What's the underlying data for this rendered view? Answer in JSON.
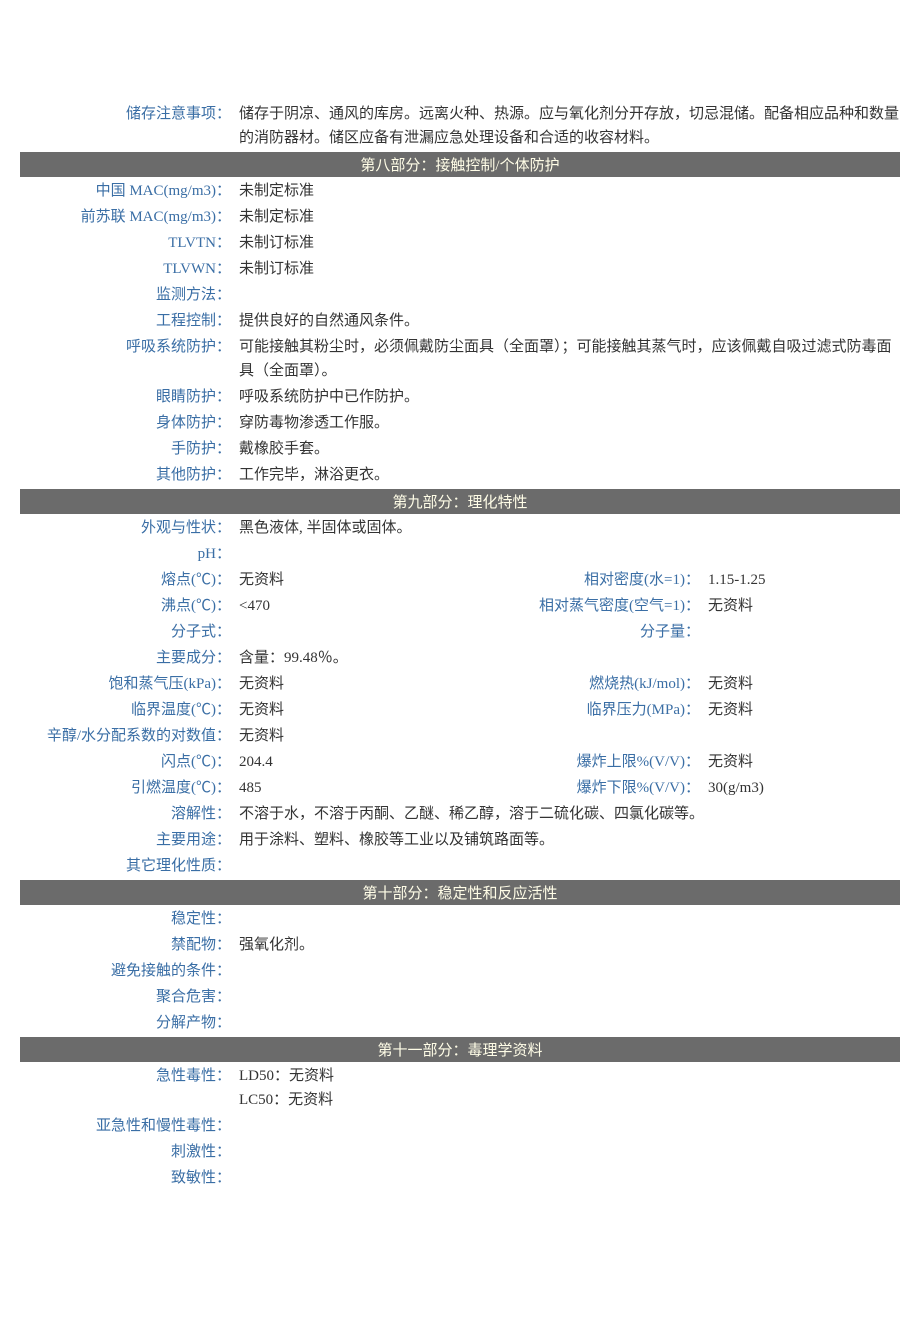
{
  "top": {
    "storage_label": "储存注意事项：",
    "storage_value": "储存于阴凉、通风的库房。远离火种、热源。应与氧化剂分开存放，切忌混储。配备相应品种和数量的消防器材。储区应备有泄漏应急处理设备和合适的收容材料。"
  },
  "section8": {
    "header": "第八部分：接触控制/个体防护",
    "china_mac_label": "中国 MAC(mg/m3)：",
    "china_mac_value": "未制定标准",
    "ussr_mac_label": "前苏联 MAC(mg/m3)：",
    "ussr_mac_value": "未制定标准",
    "tlvtn_label": "TLVTN：",
    "tlvtn_value": "未制订标准",
    "tlvwn_label": "TLVWN：",
    "tlvwn_value": "未制订标准",
    "monitor_label": "监测方法：",
    "monitor_value": "",
    "engctrl_label": "工程控制：",
    "engctrl_value": "提供良好的自然通风条件。",
    "resp_label": "呼吸系统防护：",
    "resp_value": "可能接触其粉尘时，必须佩戴防尘面具（全面罩）；可能接触其蒸气时，应该佩戴自吸过滤式防毒面具（全面罩）。",
    "eye_label": "眼睛防护：",
    "eye_value": "呼吸系统防护中已作防护。",
    "body_label": "身体防护：",
    "body_value": "穿防毒物渗透工作服。",
    "hand_label": "手防护：",
    "hand_value": "戴橡胶手套。",
    "other_label": "其他防护：",
    "other_value": "工作完毕，淋浴更衣。"
  },
  "section9": {
    "header": "第九部分：理化特性",
    "appearance_label": "外观与性状：",
    "appearance_value": "黑色液体, 半固体或固体。",
    "ph_label": "pH：",
    "ph_value": "",
    "mp_label": "熔点(℃)：",
    "mp_value": "无资料",
    "reldens_label": "相对密度(水=1)：",
    "reldens_value": "1.15-1.25",
    "bp_label": "沸点(℃)：",
    "bp_value": "<470",
    "vapdens_label": "相对蒸气密度(空气=1)：",
    "vapdens_value": "无资料",
    "formula_label": "分子式：",
    "formula_value": "",
    "mw_label": "分子量：",
    "mw_value": "",
    "main_label": "主要成分：",
    "main_value": "含量：99.48％。",
    "satvap_label": "饱和蒸气压(kPa)：",
    "satvap_value": "无资料",
    "combheat_label": "燃烧热(kJ/mol)：",
    "combheat_value": "无资料",
    "crittemp_label": "临界温度(℃)：",
    "crittemp_value": "无资料",
    "critpres_label": "临界压力(MPa)：",
    "critpres_value": "无资料",
    "logp_label": "辛醇/水分配系数的对数值：",
    "logp_value": "无资料",
    "flash_label": "闪点(℃)：",
    "flash_value": "204.4",
    "uel_label": "爆炸上限%(V/V)：",
    "uel_value": "无资料",
    "autoig_label": "引燃温度(℃)：",
    "autoig_value": "485",
    "lel_label": "爆炸下限%(V/V)：",
    "lel_value": "30(g/m3)",
    "solub_label": "溶解性：",
    "solub_value": "不溶于水，不溶于丙酮、乙醚、稀乙醇，溶于二硫化碳、四氯化碳等。",
    "use_label": "主要用途：",
    "use_value": "用于涂料、塑料、橡胶等工业以及铺筑路面等。",
    "otherpc_label": "其它理化性质：",
    "otherpc_value": ""
  },
  "section10": {
    "header": "第十部分：稳定性和反应活性",
    "stab_label": "稳定性：",
    "stab_value": "",
    "incomp_label": "禁配物：",
    "incomp_value": "强氧化剂。",
    "avoid_label": "避免接触的条件：",
    "avoid_value": "",
    "poly_label": "聚合危害：",
    "poly_value": "",
    "decomp_label": "分解产物：",
    "decomp_value": ""
  },
  "section11": {
    "header": "第十一部分：毒理学资料",
    "acute_label": "急性毒性：",
    "acute_value": "LD50：无资料\nLC50：无资料",
    "chronic_label": "亚急性和慢性毒性：",
    "chronic_value": "",
    "irrit_label": "刺激性：",
    "irrit_value": "",
    "sens_label": "致敏性：",
    "sens_value": ""
  }
}
